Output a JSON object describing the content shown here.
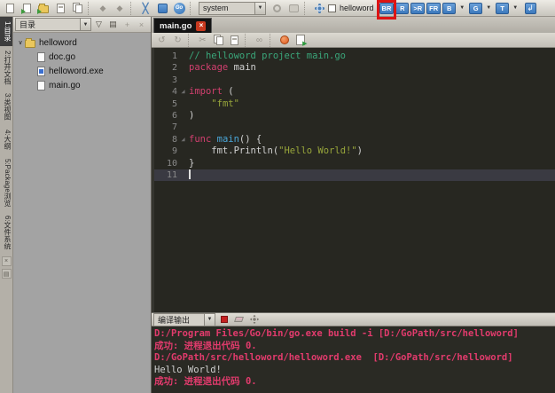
{
  "toolbar": {
    "env_combo": "system",
    "target_label": "helloword",
    "build_buttons": [
      {
        "label": "BR",
        "dropdown": false,
        "annotated": true
      },
      {
        "label": "R",
        "dropdown": false,
        "annotated": false
      },
      {
        "label": ">R",
        "dropdown": false,
        "annotated": false
      },
      {
        "label": "FR",
        "dropdown": false,
        "annotated": false
      },
      {
        "label": "B",
        "dropdown": true,
        "annotated": false
      },
      {
        "label": "G",
        "dropdown": true,
        "annotated": false
      },
      {
        "label": "T",
        "dropdown": true,
        "annotated": false
      }
    ],
    "accent_color": "#3c78bc",
    "annotation_color": "#dd1414",
    "go_badge": "Go"
  },
  "sidebar": {
    "tabs": [
      {
        "label": "1:目录",
        "selected": true
      },
      {
        "label": "2:打开文档",
        "selected": false
      },
      {
        "label": "3:类视图",
        "selected": false
      },
      {
        "label": "4:大纲",
        "selected": false
      },
      {
        "label": "5:Package浏览",
        "selected": false
      },
      {
        "label": "6:文件系统",
        "selected": false
      }
    ]
  },
  "explorer": {
    "view_combo": "目录",
    "tree": [
      {
        "label": "helloword",
        "type": "folder",
        "level": 0,
        "expanded": true
      },
      {
        "label": "doc.go",
        "type": "file",
        "level": 1
      },
      {
        "label": "helloword.exe",
        "type": "exe",
        "level": 1
      },
      {
        "label": "main.go",
        "type": "file",
        "level": 1
      }
    ]
  },
  "editor": {
    "tab": "main.go",
    "cursor_line": 11,
    "syntax_colors": {
      "comment": "#3aa67a",
      "keyword": "#d23f6f",
      "function": "#4aa6d8",
      "string": "#98a63b",
      "plain": "#d2d2d2",
      "line_number": "#8a8a8a",
      "background": "#272721",
      "current_line": "#3a3a42"
    },
    "code_lines": [
      {
        "n": 1,
        "fold": false,
        "segs": [
          {
            "t": "// helloword project main.go",
            "c": "comment"
          }
        ]
      },
      {
        "n": 2,
        "fold": false,
        "segs": [
          {
            "t": "package",
            "c": "keyword"
          },
          {
            "t": " main",
            "c": "plain"
          }
        ]
      },
      {
        "n": 3,
        "fold": false,
        "segs": []
      },
      {
        "n": 4,
        "fold": true,
        "segs": [
          {
            "t": "import",
            "c": "keyword"
          },
          {
            "t": " (",
            "c": "plain"
          }
        ]
      },
      {
        "n": 5,
        "fold": false,
        "segs": [
          {
            "t": "    ",
            "c": "plain"
          },
          {
            "t": "\"fmt\"",
            "c": "string"
          }
        ]
      },
      {
        "n": 6,
        "fold": false,
        "segs": [
          {
            "t": ")",
            "c": "plain"
          }
        ]
      },
      {
        "n": 7,
        "fold": false,
        "segs": []
      },
      {
        "n": 8,
        "fold": true,
        "segs": [
          {
            "t": "func",
            "c": "keyword"
          },
          {
            "t": " ",
            "c": "plain"
          },
          {
            "t": "main",
            "c": "function"
          },
          {
            "t": "() {",
            "c": "plain"
          }
        ]
      },
      {
        "n": 9,
        "fold": false,
        "segs": [
          {
            "t": "    fmt.Println(",
            "c": "plain"
          },
          {
            "t": "\"Hello World!\"",
            "c": "string"
          },
          {
            "t": ")",
            "c": "plain"
          }
        ]
      },
      {
        "n": 10,
        "fold": false,
        "segs": [
          {
            "t": "}",
            "c": "plain"
          }
        ]
      },
      {
        "n": 11,
        "fold": false,
        "segs": [],
        "cursor": true
      }
    ]
  },
  "output": {
    "view_combo": "编译输出",
    "command_color": "#e23b6d",
    "plain_color": "#cfcfcf",
    "lines": [
      {
        "text": "D:/Program Files/Go/bin/go.exe build -i [D:/GoPath/src/helloword]",
        "style": "command"
      },
      {
        "text": "成功: 进程退出代码 0.",
        "style": "command"
      },
      {
        "text": "D:/GoPath/src/helloword/helloword.exe  [D:/GoPath/src/helloword]",
        "style": "command"
      },
      {
        "text": "Hello World!",
        "style": "plain"
      },
      {
        "text": "成功: 进程退出代码 0.",
        "style": "command"
      }
    ]
  }
}
